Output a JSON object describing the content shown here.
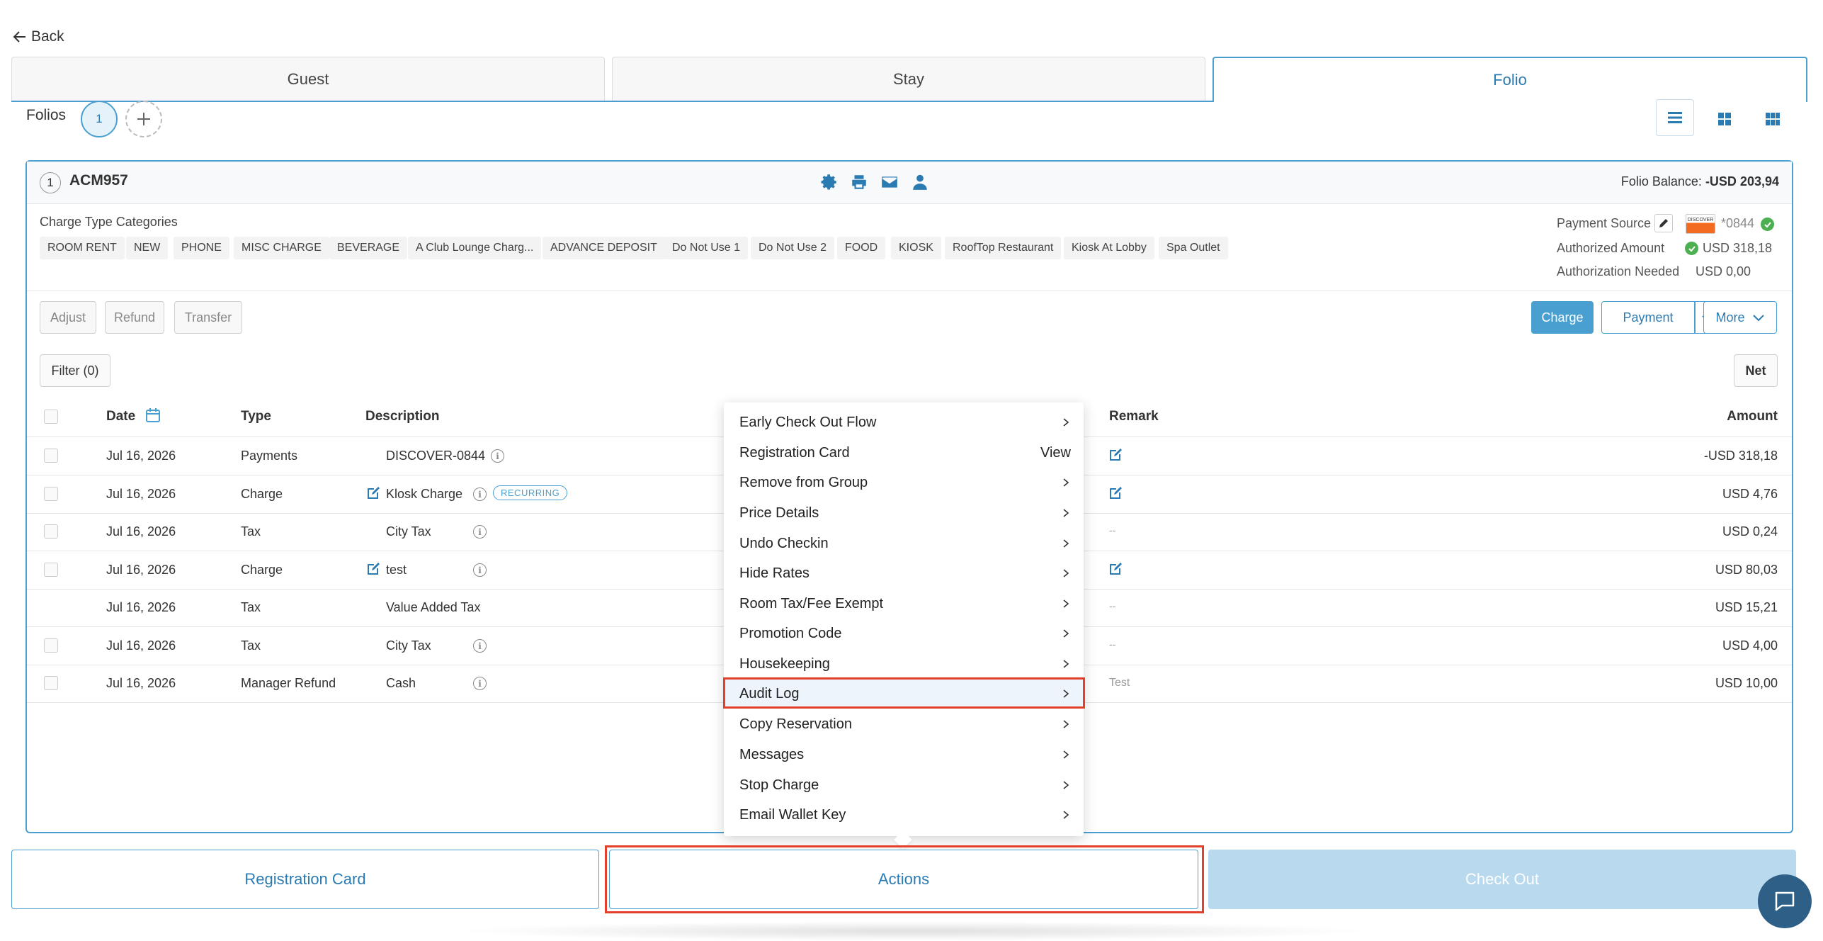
{
  "nav": {
    "back_label": "Back"
  },
  "tabs": [
    {
      "label": "Guest",
      "active": false
    },
    {
      "label": "Stay",
      "active": false
    },
    {
      "label": "Folio",
      "active": true
    }
  ],
  "folios": {
    "label": "Folios",
    "current": "1",
    "add_icon": "plus-icon"
  },
  "view_modes": [
    "list-view-icon",
    "grid-view-icon",
    "dense-grid-view-icon"
  ],
  "folio": {
    "number": "1",
    "name": "ACM957",
    "header_icons": [
      "gear-icon",
      "printer-icon",
      "mail-icon",
      "user-icon"
    ],
    "balance_label": "Folio Balance:",
    "balance_value": "-USD 203,94"
  },
  "charge_type": {
    "label": "Charge Type Categories",
    "chips": [
      "ROOM RENT",
      "NEW",
      "PHONE",
      "MISC CHARGE",
      "BEVERAGE",
      "A Club Lounge Charg...",
      "ADVANCE DEPOSIT",
      "Do Not Use 1",
      "Do Not Use 2",
      "FOOD",
      "KIOSK",
      "RoofTop Restaurant",
      "Kiosk At Lobby",
      "Spa Outlet"
    ]
  },
  "payment_source": {
    "label": "Payment Source",
    "card_brand": "DISCOVER",
    "card_last4": "*0844",
    "authorized_label": "Authorized Amount",
    "authorized_value": "USD 318,18",
    "needed_label": "Authorization Needed",
    "needed_value": "USD 0,00"
  },
  "actions_left": [
    "Adjust",
    "Refund",
    "Transfer"
  ],
  "actions_right": {
    "charge": "Charge",
    "payment": "Payment",
    "more": "More"
  },
  "filter": {
    "label": "Filter (0)",
    "net": "Net"
  },
  "table": {
    "headers": {
      "date": "Date",
      "type": "Type",
      "description": "Description",
      "remark": "Remark",
      "amount": "Amount"
    },
    "rows": [
      {
        "date": "Jul 16, 2026",
        "type": "Payments",
        "description": "DISCOVER-0844",
        "remark": "",
        "amount": "-USD 318,18"
      },
      {
        "date": "Jul 16, 2026",
        "type": "Charge",
        "description": "Klosk Charge",
        "badge": "RECURRING",
        "remark": "",
        "amount": "USD 4,76"
      },
      {
        "date": "Jul 16, 2026",
        "type": "Tax",
        "description": "City Tax",
        "remark": "--",
        "amount": "USD 0,24"
      },
      {
        "date": "Jul 16, 2026",
        "type": "Charge",
        "description": "test",
        "remark": "",
        "amount": "USD 80,03"
      },
      {
        "date": "Jul 16, 2026",
        "type": "Tax",
        "description": "Value Added Tax",
        "remark": "--",
        "amount": "USD 15,21"
      },
      {
        "date": "Jul 16, 2026",
        "type": "Tax",
        "description": "City Tax",
        "remark": "--",
        "amount": "USD 4,00"
      },
      {
        "date": "Jul 16, 2026",
        "type": "Manager Refund",
        "description": "Cash",
        "remark": "Test",
        "amount": "USD 10,00"
      }
    ]
  },
  "menu": {
    "items": [
      {
        "label": "Early Check Out Flow"
      },
      {
        "label": "Registration Card",
        "trailing": "View"
      },
      {
        "label": "Remove from Group"
      },
      {
        "label": "Price Details"
      },
      {
        "label": "Undo Checkin"
      },
      {
        "label": "Hide Rates"
      },
      {
        "label": "Room Tax/Fee Exempt"
      },
      {
        "label": "Promotion Code"
      },
      {
        "label": "Housekeeping"
      },
      {
        "label": "Audit Log",
        "highlighted": true
      },
      {
        "label": "Copy Reservation"
      },
      {
        "label": "Messages"
      },
      {
        "label": "Stop Charge"
      },
      {
        "label": "Email Wallet Key"
      }
    ]
  },
  "footer": {
    "registration_card": "Registration Card",
    "actions": "Actions",
    "check_out": "Check Out"
  },
  "colors": {
    "accent": "#4a9fd1",
    "primary_button": "#4a9fd1",
    "highlight_outline": "#e2402c",
    "checkout_disabled": "#b9d9ee"
  }
}
